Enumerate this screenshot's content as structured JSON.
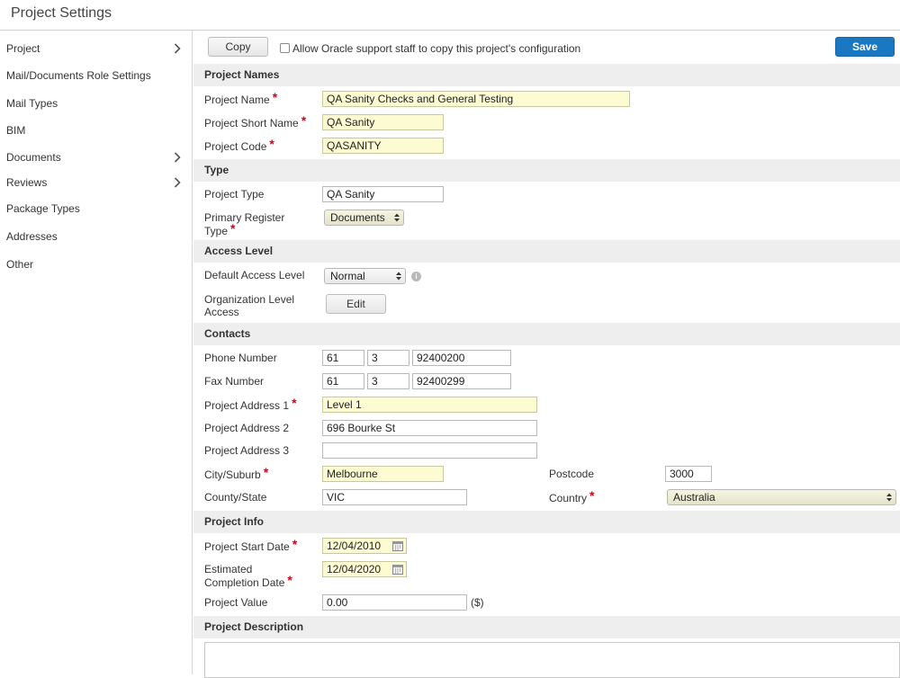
{
  "page": {
    "title": "Project Settings"
  },
  "sidebar": {
    "items": [
      {
        "label": "Project",
        "has_chevron": true
      },
      {
        "label": "Mail/Documents Role Settings",
        "has_chevron": false
      },
      {
        "label": "Mail Types",
        "has_chevron": false
      },
      {
        "label": "BIM",
        "has_chevron": false
      },
      {
        "label": "Documents",
        "has_chevron": true
      },
      {
        "label": "Reviews",
        "has_chevron": true
      },
      {
        "label": "Package Types",
        "has_chevron": false
      },
      {
        "label": "Addresses",
        "has_chevron": false
      },
      {
        "label": "Other",
        "has_chevron": false
      }
    ]
  },
  "toolbar": {
    "copy_label": "Copy",
    "allow_copy_label": "Allow Oracle support staff to copy this project's configuration",
    "allow_copy_checked": false,
    "save_label": "Save"
  },
  "sections": {
    "project_names": "Project Names",
    "type": "Type",
    "access_level": "Access Level",
    "contacts": "Contacts",
    "project_info": "Project Info",
    "project_description": "Project Description"
  },
  "fields": {
    "project_name": {
      "label": "Project Name",
      "value": "QA Sanity Checks and General Testing",
      "required": "*"
    },
    "project_short_name": {
      "label": "Project Short Name",
      "value": "QA Sanity",
      "required": "*"
    },
    "project_code": {
      "label": "Project Code",
      "value": "QASANITY",
      "required": "*"
    },
    "project_type": {
      "label": "Project Type",
      "value": "QA Sanity"
    },
    "primary_register_type": {
      "label_line1": "Primary Register",
      "label_line2": "Type",
      "value": "Documents",
      "required": "*"
    },
    "default_access_level": {
      "label": "Default Access Level",
      "value": "Normal",
      "info_icon": "info-icon"
    },
    "organization_level_access": {
      "label_line1": "Organization Level",
      "label_line2": "Access",
      "button_label": "Edit"
    },
    "phone_number": {
      "label": "Phone Number",
      "country": "61",
      "area": "3",
      "number": "92400200"
    },
    "fax_number": {
      "label": "Fax Number",
      "country": "61",
      "area": "3",
      "number": "92400299"
    },
    "project_address_1": {
      "label": "Project Address 1",
      "value": "Level 1",
      "required": "*"
    },
    "project_address_2": {
      "label": "Project Address 2",
      "value": "696 Bourke St"
    },
    "project_address_3": {
      "label": "Project Address 3",
      "value": ""
    },
    "city_suburb": {
      "label": "City/Suburb",
      "value": "Melbourne",
      "required": "*"
    },
    "postcode": {
      "label": "Postcode",
      "value": "3000"
    },
    "county_state": {
      "label": "County/State",
      "value": "VIC"
    },
    "country": {
      "label": "Country",
      "value": "Australia",
      "required": "*"
    },
    "project_start_date": {
      "label": "Project Start Date",
      "value": "12/04/2010",
      "required": "*"
    },
    "estimated_completion_date": {
      "label_line1": "Estimated",
      "label_line2": "Completion Date",
      "value": "12/04/2020",
      "required": "*"
    },
    "project_value": {
      "label": "Project Value",
      "value": "0.00",
      "unit": "($)"
    },
    "project_description": {
      "value": ""
    }
  },
  "icons": {
    "chevron": "chevron-right-icon",
    "select_arrows": "select-arrows-icon",
    "calendar": "calendar-icon",
    "info": "info-icon"
  },
  "colors": {
    "required_field_bg": "#fdfbd2",
    "required_marker": "#d0021b",
    "save_button": "#1a78c2",
    "section_header_bg": "#eeeeee"
  }
}
